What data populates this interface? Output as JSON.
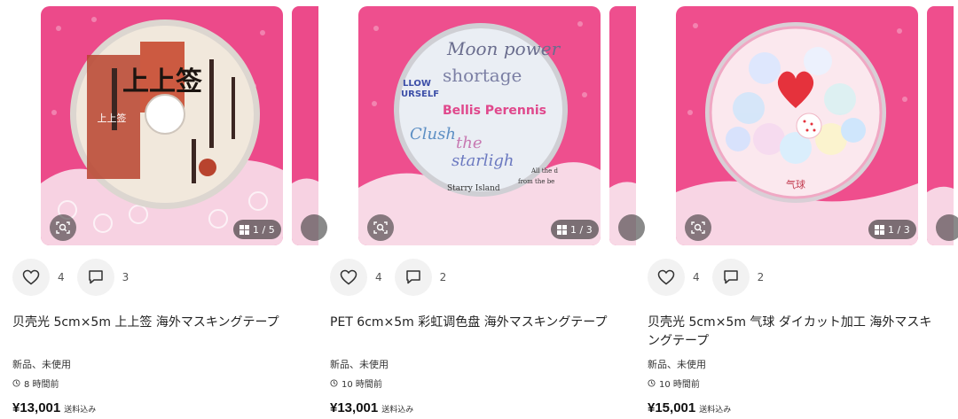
{
  "products": [
    {
      "photo_desc": "washi-tape-calligraphy",
      "image_counter": "1 / 5",
      "likes": "4",
      "comments": "3",
      "title": "贝壳光 5cm×5m 上上签 海外マスキングテープ",
      "condition": "新品、未使用",
      "posted": "8 時間前",
      "price": "¥13,001",
      "shipping": "送料込み"
    },
    {
      "photo_desc": "washi-tape-moon-power",
      "image_counter": "1 / 3",
      "likes": "4",
      "comments": "2",
      "title": "PET 6cm×5m 彩虹调色盘 海外マスキングテープ",
      "condition": "新品、未使用",
      "posted": "10 時間前",
      "price": "¥13,001",
      "shipping": "送料込み"
    },
    {
      "photo_desc": "washi-tape-balloons",
      "image_counter": "1 / 3",
      "likes": "4",
      "comments": "2",
      "title": "贝壳光 5cm×5m 气球 ダイカット加工 海外マスキングテープ",
      "condition": "新品、未使用",
      "posted": "10 時間前",
      "price": "¥15,001",
      "shipping": "送料込み"
    }
  ],
  "photo_text": {
    "tape1_big": "上上签",
    "tape1_small": "上上签",
    "tape2_lines": [
      "Moon power",
      "shortage",
      "LLOW",
      "URSELF",
      "Bellis Perennis",
      "Clush",
      "the",
      "starligh",
      "Starry Island",
      "All the d",
      "from the be"
    ],
    "tape3_label": "气球"
  },
  "colors": {
    "photo_pink": "#ee4f8e",
    "lace": "#f7d7e4",
    "overlay": "#333333"
  }
}
